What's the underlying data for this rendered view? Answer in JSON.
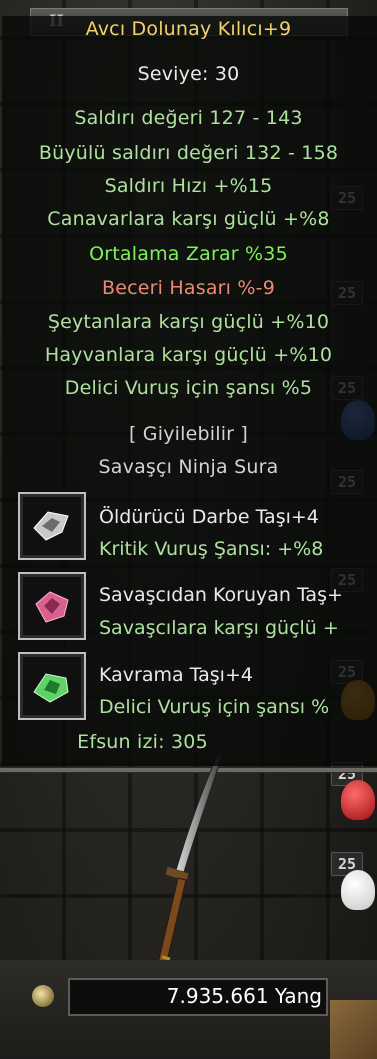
{
  "item": {
    "name": "Avcı Dolunay Kılıcı+9",
    "level": "Seviye: 30",
    "stats": [
      "Saldırı değeri 127 - 143",
      "Büyülü saldırı değeri 132 - 158",
      "Saldırı Hızı +%15",
      "Canavarlara karşı güçlü +%8"
    ],
    "bonus_bright": "Ortalama Zarar %35",
    "bonus_red": "Beceri Hasarı %-9",
    "bonuses": [
      "Şeytanlara karşı güçlü +%10",
      "Hayvanlara karşı güçlü +%10",
      "Delici Vuruş için şansı %5"
    ],
    "wearable": "[ Giyilebilir ]",
    "classes": "Savaşçı Ninja Sura",
    "stones": [
      {
        "name": "Öldürücü Darbe Taşı+4",
        "effect": "Kritik Vuruş Şansı: +%8",
        "icon": "critical-stone-icon"
      },
      {
        "name": "Savaşcıdan Koruyan Taş+",
        "effect": "Savaşcılara karşı güçlü +",
        "icon": "warrior-defense-stone-icon"
      },
      {
        "name": "Kavrama Taşı+4",
        "effect": "Delici Vuruş için şansı %",
        "icon": "penetration-stone-icon"
      }
    ],
    "enchant": "Efsun izi: 305"
  },
  "inventory": {
    "slot_count_label": "25",
    "top_left_label": "II"
  },
  "wallet": {
    "yang": "7.935.661 Yang"
  },
  "colors": {
    "title": "#f1d16b",
    "stat": "#aee09f",
    "bright": "#7df25a",
    "negative": "#ea8a74"
  }
}
